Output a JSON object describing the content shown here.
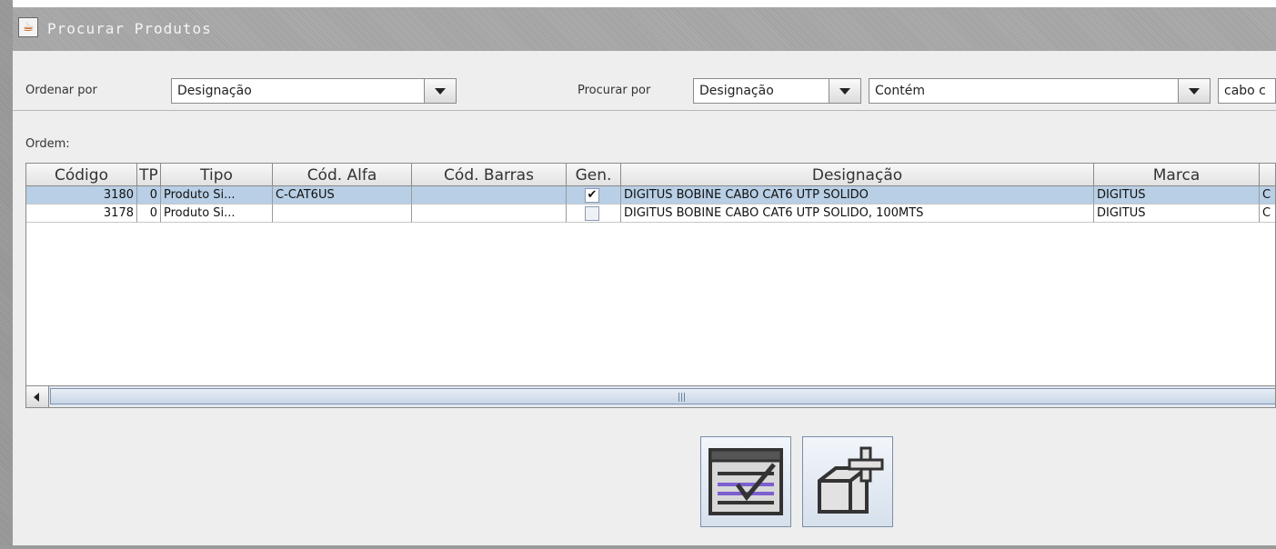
{
  "window": {
    "title": "Procurar Produtos",
    "icon": "java-cup-icon"
  },
  "filters": {
    "order_label": "Ordenar por",
    "order_value": "Designação",
    "search_label": "Procurar por",
    "search_field_value": "Designação",
    "search_mode_value": "Contém",
    "search_text": "cabo c"
  },
  "order_label": "Ordem:",
  "table": {
    "columns": [
      "Código",
      "TP",
      "Tipo",
      "Cód. Alfa",
      "Cód. Barras",
      "Gen.",
      "Designação",
      "Marca"
    ],
    "rows": [
      {
        "codigo": "3180",
        "tp": "0",
        "tipo": "Produto Si...",
        "cod_alfa": "C-CAT6US",
        "cod_barras": "",
        "gen": true,
        "designacao": "DIGITUS BOBINE CABO CAT6 UTP SOLIDO",
        "marca": "DIGITUS",
        "extra": "C",
        "selected": true
      },
      {
        "codigo": "3178",
        "tp": "0",
        "tipo": "Produto Si...",
        "cod_alfa": "",
        "cod_barras": "",
        "gen": false,
        "designacao": "DIGITUS BOBINE CABO CAT6 UTP SOLIDO, 100MTS",
        "marca": "DIGITUS",
        "extra": "C",
        "selected": false
      }
    ]
  },
  "buttons": {
    "select_icon": "checklist-icon",
    "add_icon": "add-box-icon"
  },
  "colors": {
    "selection": "#b8cfe5",
    "accent": "#7d5fd0"
  }
}
